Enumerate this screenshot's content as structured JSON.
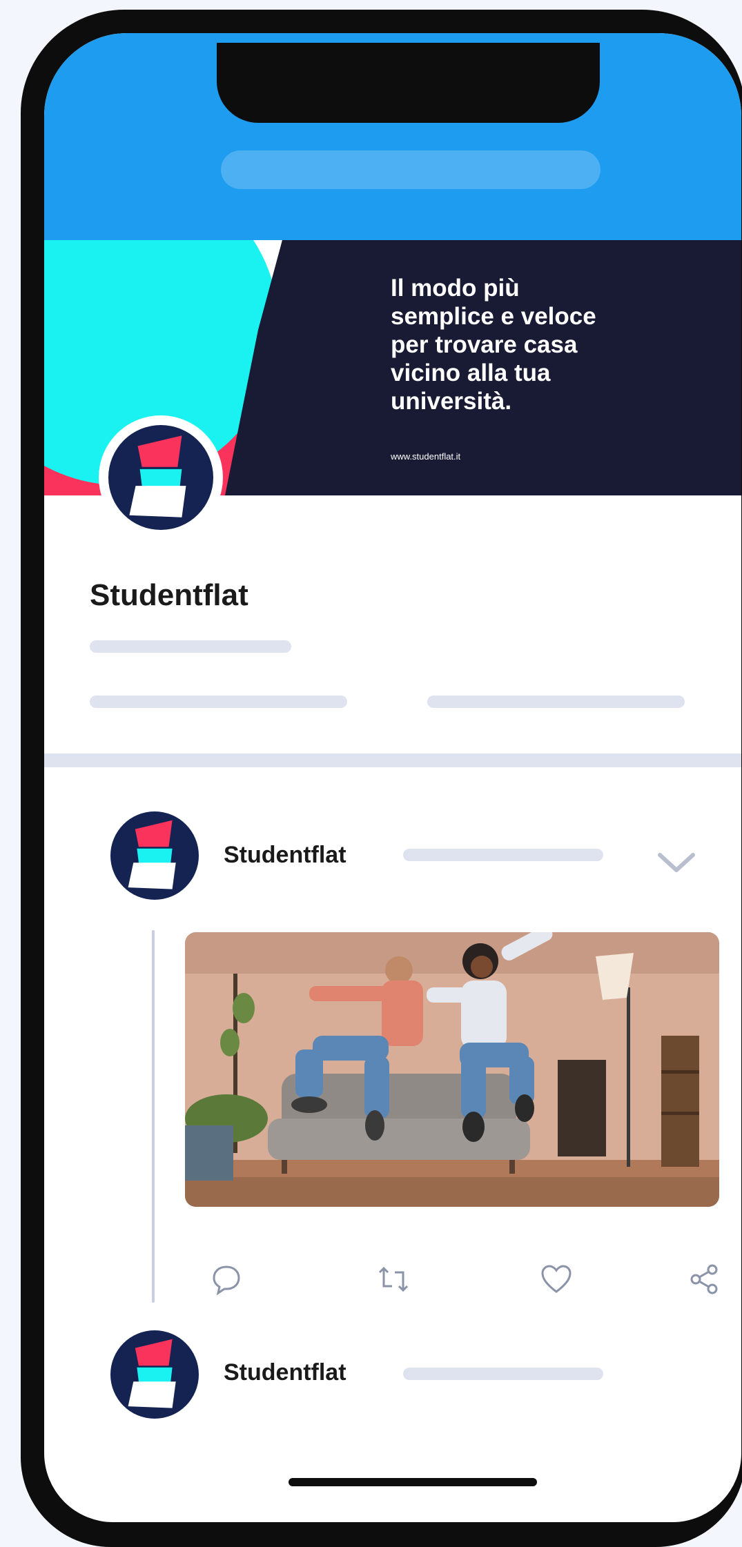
{
  "banner": {
    "lines": [
      "Il modo più",
      "semplice e veloce",
      "per trovare casa",
      "vicino alla tua",
      "università."
    ],
    "url": "www.studentflat.it"
  },
  "profile": {
    "name": "Studentflat"
  },
  "posts": [
    {
      "author": "Studentflat",
      "has_image": true
    },
    {
      "author": "Studentflat",
      "has_image": false
    }
  ],
  "actions": [
    "reply-icon",
    "retweet-icon",
    "like-icon",
    "share-icon"
  ],
  "colors": {
    "topbar": "#1e9cef",
    "banner_bg": "#191a33",
    "cyan": "#19f2f0",
    "pink": "#f9335b",
    "navy": "#152353",
    "placeholder": "#dfe3ef"
  }
}
